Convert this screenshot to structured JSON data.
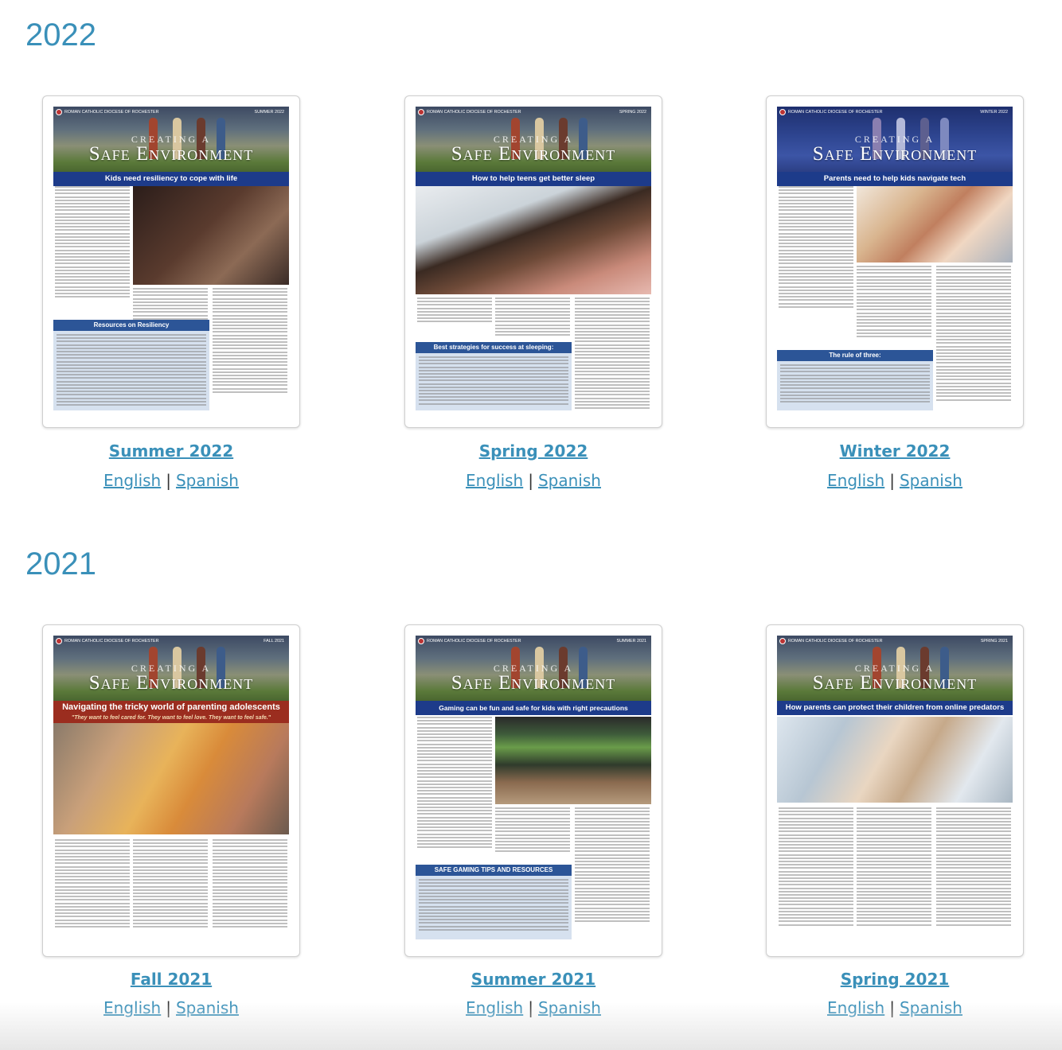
{
  "years": [
    {
      "year": "2022",
      "issues": [
        {
          "title": "Summer 2022",
          "english": "English",
          "separator": "|",
          "spanish": "Spanish",
          "cover": {
            "diocese": "ROMAN CATHOLIC DIOCESE OF ROCHESTER",
            "season": "SUMMER 2022",
            "creating": "CREATING A",
            "safe": "Safe Environment",
            "headline": "Kids need resiliency to cope with life",
            "box_title": "Resources on Resiliency"
          }
        },
        {
          "title": "Spring 2022",
          "english": "English",
          "separator": "|",
          "spanish": "Spanish",
          "cover": {
            "diocese": "ROMAN CATHOLIC DIOCESE OF ROCHESTER",
            "season": "SPRING 2022",
            "creating": "CREATING A",
            "safe": "Safe Environment",
            "headline": "How to help teens get better sleep",
            "box_title": "Best strategies for success at sleeping:"
          }
        },
        {
          "title": "Winter 2022",
          "english": "English",
          "separator": "|",
          "spanish": "Spanish",
          "cover": {
            "diocese": "ROMAN CATHOLIC DIOCESE OF ROCHESTER",
            "season": "WINTER 2022",
            "creating": "CREATING A",
            "safe": "Safe Environment",
            "headline": "Parents need to help kids navigate tech",
            "box_title": "The rule of three:"
          }
        }
      ]
    },
    {
      "year": "2021",
      "issues": [
        {
          "title": "Fall 2021",
          "english": "English",
          "separator": "|",
          "spanish": "Spanish",
          "cover": {
            "diocese": "ROMAN CATHOLIC DIOCESE OF ROCHESTER",
            "season": "FALL 2021",
            "creating": "CREATING A",
            "safe": "Safe Environment",
            "headline": "Navigating the tricky world of parenting adolescents",
            "subheadline": "\"They want to feel cared for. They want to feel love. They want to feel safe.\""
          }
        },
        {
          "title": "Summer 2021",
          "english": "English",
          "separator": "|",
          "spanish": "Spanish",
          "cover": {
            "diocese": "ROMAN CATHOLIC DIOCESE OF ROCHESTER",
            "season": "SUMMER 2021",
            "creating": "CREATING A",
            "safe": "Safe Environment",
            "headline": "Gaming can be fun and safe for kids with right precautions",
            "box_title": "SAFE GAMING TIPS AND RESOURCES"
          }
        },
        {
          "title": "Spring 2021",
          "english": "English",
          "separator": "|",
          "spanish": "Spanish",
          "cover": {
            "diocese": "ROMAN CATHOLIC DIOCESE OF ROCHESTER",
            "season": "SPRING 2021",
            "creating": "CREATING A",
            "safe": "Safe Environment",
            "headline": "How parents can protect their children from online predators"
          }
        }
      ]
    }
  ],
  "colors": {
    "link": "#3a90b9",
    "heading": "#3a90b9",
    "banner_blue": "#1d3b8a",
    "banner_red": "#9b2d1f",
    "box_bg": "#d6e1ef"
  }
}
